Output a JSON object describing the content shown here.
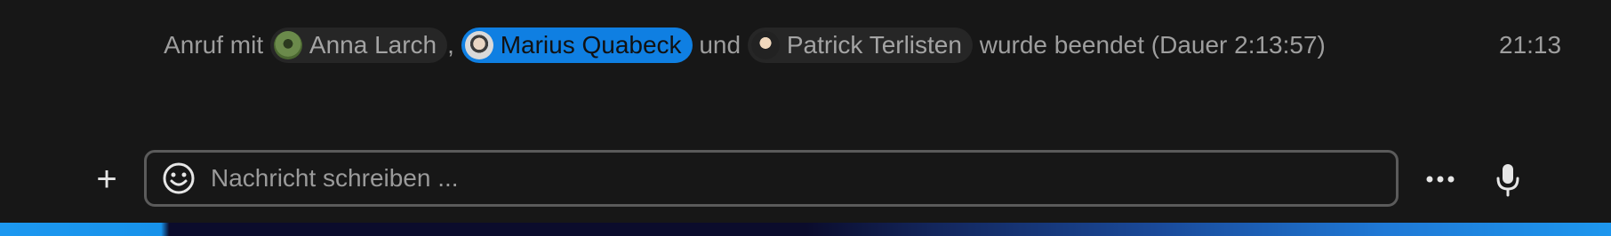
{
  "call_message": {
    "prefix": "Anruf mit",
    "participants": [
      {
        "name": "Anna Larch",
        "active": false,
        "avatar_icon": "avatar-anna"
      },
      {
        "name": "Marius Quabeck",
        "active": true,
        "avatar_icon": "avatar-marius"
      },
      {
        "name": "Patrick Terlisten",
        "active": false,
        "avatar_icon": "avatar-patrick"
      }
    ],
    "separator_comma": ",",
    "separator_and": "und",
    "suffix": "wurde beendet (Dauer 2:13:57)",
    "time": "21:13"
  },
  "composer": {
    "add_label": "+",
    "add_icon": "plus-icon",
    "emoji_icon": "smiley-icon",
    "placeholder": "Nachricht schreiben ...",
    "value": "",
    "more_icon": "more-dots-icon",
    "mic_icon": "microphone-icon"
  },
  "colors": {
    "background": "#171717",
    "accent": "#0f7fe2",
    "chip_background": "#262626",
    "text_muted": "#9e9e9e"
  }
}
